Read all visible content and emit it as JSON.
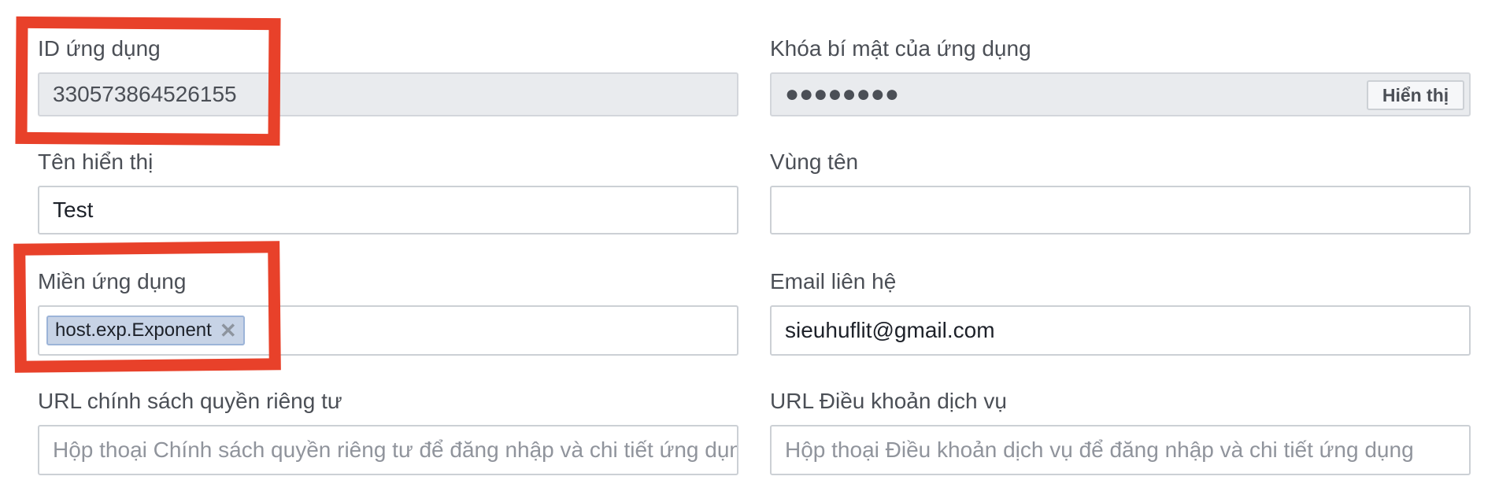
{
  "fields": {
    "app_id": {
      "label": "ID ứng dụng",
      "value": "330573864526155"
    },
    "app_secret": {
      "label": "Khóa bí mật của ứng dụng",
      "masked_value": "●●●●●●●●",
      "show_button": "Hiển thị"
    },
    "display_name": {
      "label": "Tên hiển thị",
      "value": "Test"
    },
    "namespace": {
      "label": "Vùng tên",
      "value": ""
    },
    "app_domains": {
      "label": "Miền ứng dụng",
      "tags": [
        "host.exp.Exponent"
      ],
      "remove_symbol": "✕"
    },
    "contact_email": {
      "label": "Email liên hệ",
      "value": "sieuhuflit@gmail.com"
    },
    "privacy_url": {
      "label": "URL chính sách quyền riêng tư",
      "placeholder": "Hộp thoại Chính sách quyền riêng tư để đăng nhập và chi tiết ứng dụng"
    },
    "terms_url": {
      "label": "URL Điều khoản dịch vụ",
      "placeholder": "Hộp thoại Điều khoản dịch vụ để đăng nhập và chi tiết ứng dụng"
    }
  },
  "annotation_color": "#e8412a"
}
